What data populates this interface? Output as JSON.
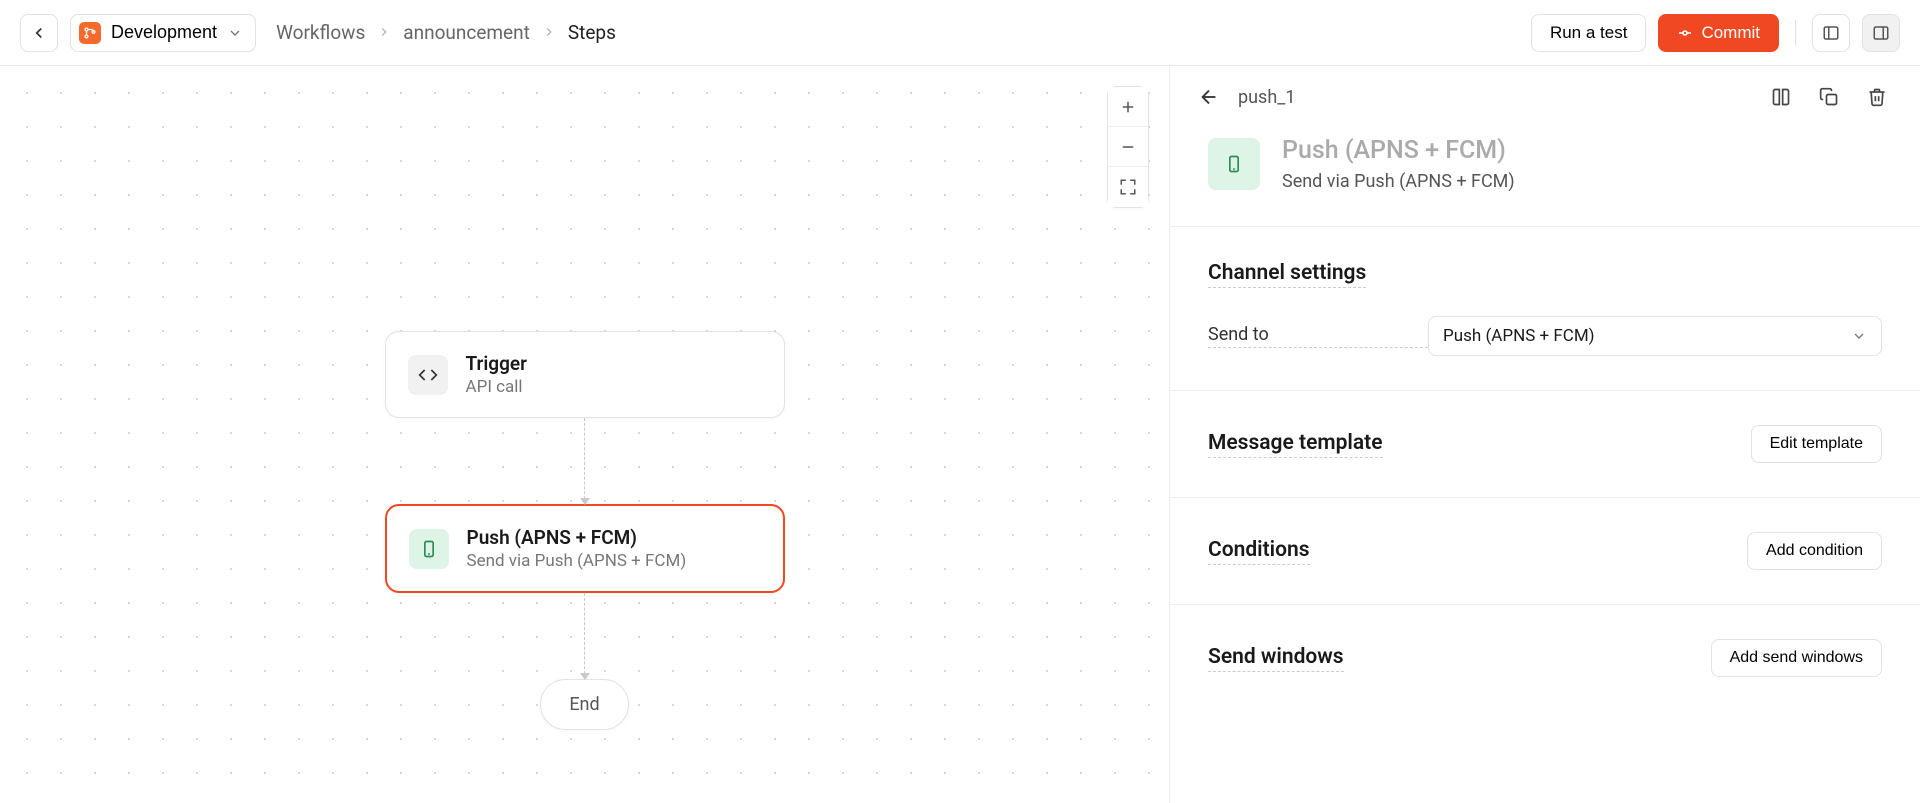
{
  "header": {
    "environment": "Development",
    "breadcrumbs": [
      "Workflows",
      "announcement",
      "Steps"
    ],
    "run_test_label": "Run a test",
    "commit_label": "Commit"
  },
  "canvas": {
    "nodes": {
      "trigger": {
        "title": "Trigger",
        "subtitle": "API call"
      },
      "push": {
        "title": "Push (APNS + FCM)",
        "subtitle": "Send via Push (APNS + FCM)"
      },
      "end": {
        "label": "End"
      }
    }
  },
  "panel": {
    "step_id": "push_1",
    "title": "Push (APNS + FCM)",
    "subtitle": "Send via Push (APNS + FCM)",
    "channel_settings": {
      "heading": "Channel settings",
      "send_to_label": "Send to",
      "send_to_value": "Push (APNS + FCM)"
    },
    "message_template": {
      "heading": "Message template",
      "edit_label": "Edit template"
    },
    "conditions": {
      "heading": "Conditions",
      "add_label": "Add condition"
    },
    "send_windows": {
      "heading": "Send windows",
      "add_label": "Add send windows"
    }
  }
}
